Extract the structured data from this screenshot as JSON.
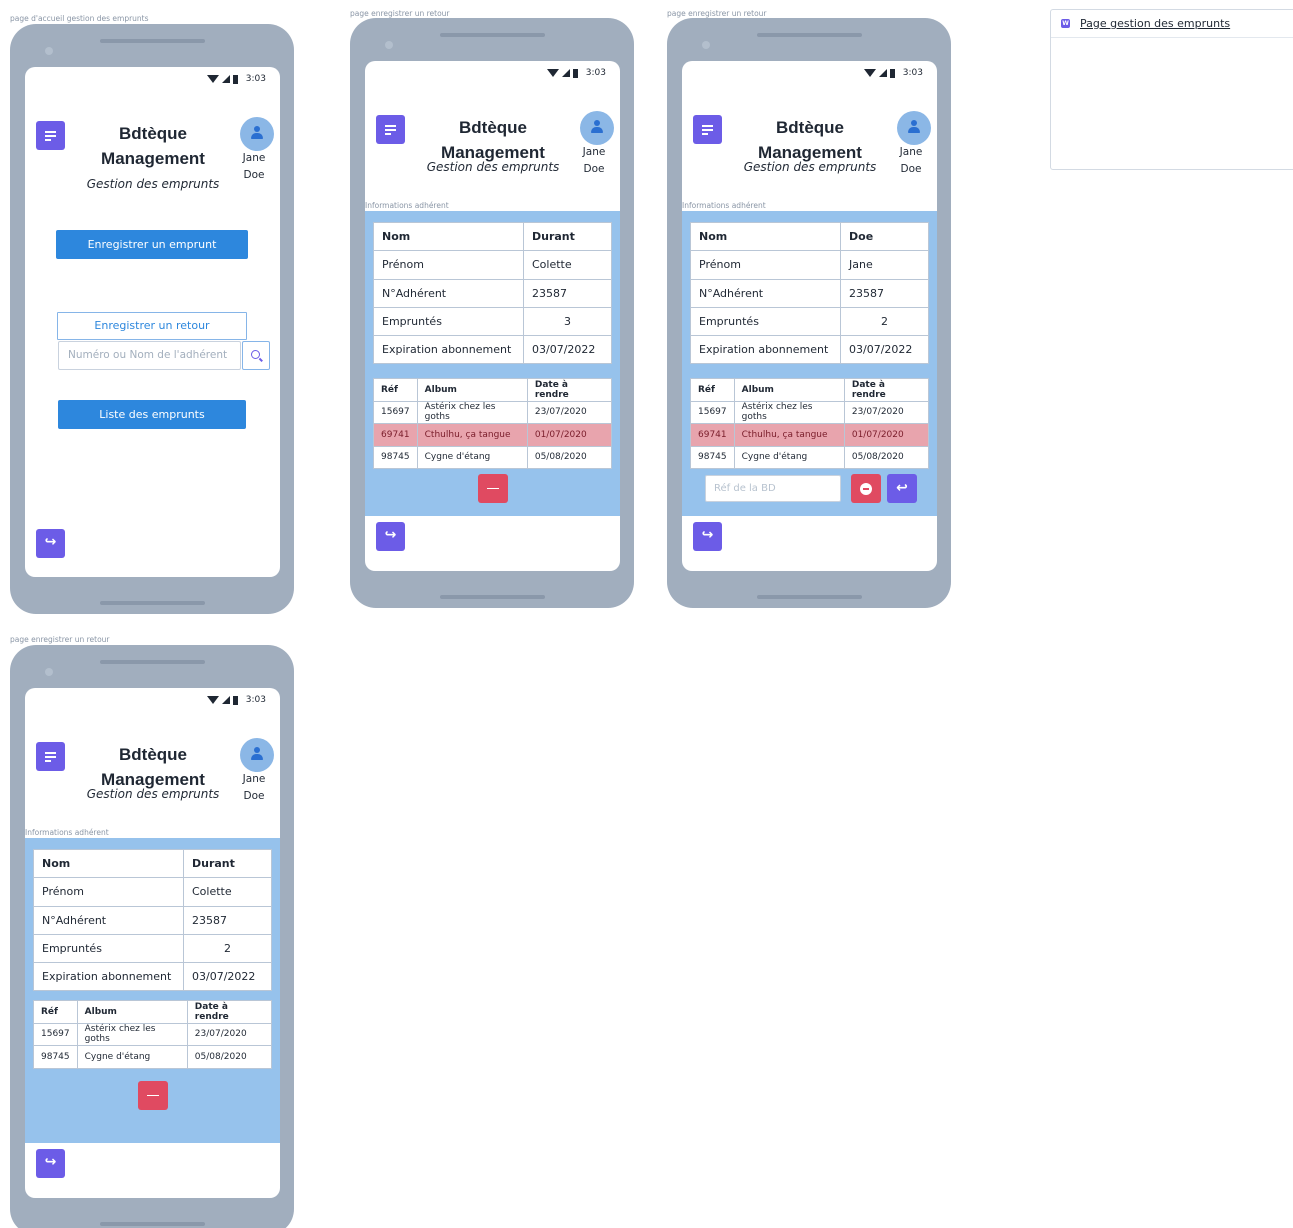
{
  "frames": [
    {
      "label": "page d'accueil gestion des emprunts"
    },
    {
      "label": "page enregistrer un retour"
    },
    {
      "label": "page enregistrer un retour"
    },
    {
      "label": "page enregistrer un retour"
    }
  ],
  "status_bar": {
    "time": "3:03"
  },
  "header": {
    "title_line1": "Bdtèque",
    "title_line2": "Management",
    "subtitle": "Gestion des emprunts"
  },
  "user": {
    "first_name": "Jane",
    "last_name": "Doe"
  },
  "home": {
    "register_loan_label": "Enregistrer un emprunt",
    "register_return_label": "Enregistrer un retour",
    "search_placeholder": "Numéro ou Nom de l'adhérent",
    "loan_list_label": "Liste des emprunts"
  },
  "member_section_label": "Informations adhérent",
  "return_screens": [
    {
      "member": {
        "nom_label": "Nom",
        "nom": "Durant",
        "prenom_label": "Prénom",
        "prenom": "Colette",
        "numero_label": "N°Adhérent",
        "numero": "23587",
        "empruntes_label": "Empruntés",
        "empruntes": "3",
        "expiration_label": "Expiration abonnement",
        "expiration": "03/07/2022"
      },
      "loans": [
        {
          "ref": "15697",
          "album": "Astérix chez les goths",
          "date": "23/07/2020",
          "late": false
        },
        {
          "ref": "69741",
          "album": "Cthulhu, ça tangue",
          "date": "01/07/2020",
          "late": true
        },
        {
          "ref": "98745",
          "album": "Cygne d'étang",
          "date": "05/08/2020",
          "late": false
        }
      ]
    },
    {
      "member": {
        "nom_label": "Nom",
        "nom": "Doe",
        "prenom_label": "Prénom",
        "prenom": "Jane",
        "numero_label": "N°Adhérent",
        "numero": "23587",
        "empruntes_label": "Empruntés",
        "empruntes": "2",
        "expiration_label": "Expiration abonnement",
        "expiration": "03/07/2022"
      },
      "loans": [
        {
          "ref": "15697",
          "album": "Astérix chez les goths",
          "date": "23/07/2020",
          "late": false
        },
        {
          "ref": "69741",
          "album": "Cthulhu, ça tangue",
          "date": "01/07/2020",
          "late": true
        },
        {
          "ref": "98745",
          "album": "Cygne d'étang",
          "date": "05/08/2020",
          "late": false
        }
      ],
      "ref_placeholder": "Réf de la BD"
    },
    {
      "member": {
        "nom_label": "Nom",
        "nom": "Durant",
        "prenom_label": "Prénom",
        "prenom": "Colette",
        "numero_label": "N°Adhérent",
        "numero": "23587",
        "empruntes_label": "Empruntés",
        "empruntes": "2",
        "expiration_label": "Expiration abonnement",
        "expiration": "03/07/2022"
      },
      "loans": [
        {
          "ref": "15697",
          "album": "Astérix chez les goths",
          "date": "23/07/2020",
          "late": false
        },
        {
          "ref": "98745",
          "album": "Cygne d'étang",
          "date": "05/08/2020",
          "late": false
        }
      ]
    }
  ],
  "loan_table_headers": {
    "ref": "Réf",
    "album": "Album",
    "date": "Date à rendre"
  },
  "side_panel": {
    "badge": "W",
    "link_label": "Page gestion des emprunts"
  },
  "icons": {
    "menu": "menu-icon",
    "avatar": "user-icon",
    "search": "search-icon",
    "back": "share-forward-icon",
    "remove": "minus-icon",
    "reply": "reply-icon"
  },
  "colors": {
    "accent": "#6c5ce7",
    "primary": "#2d87dd",
    "panel": "#96c2ec",
    "danger": "#e04a61",
    "late_row": "#e8a4ad",
    "phone": "#a1aebe"
  }
}
